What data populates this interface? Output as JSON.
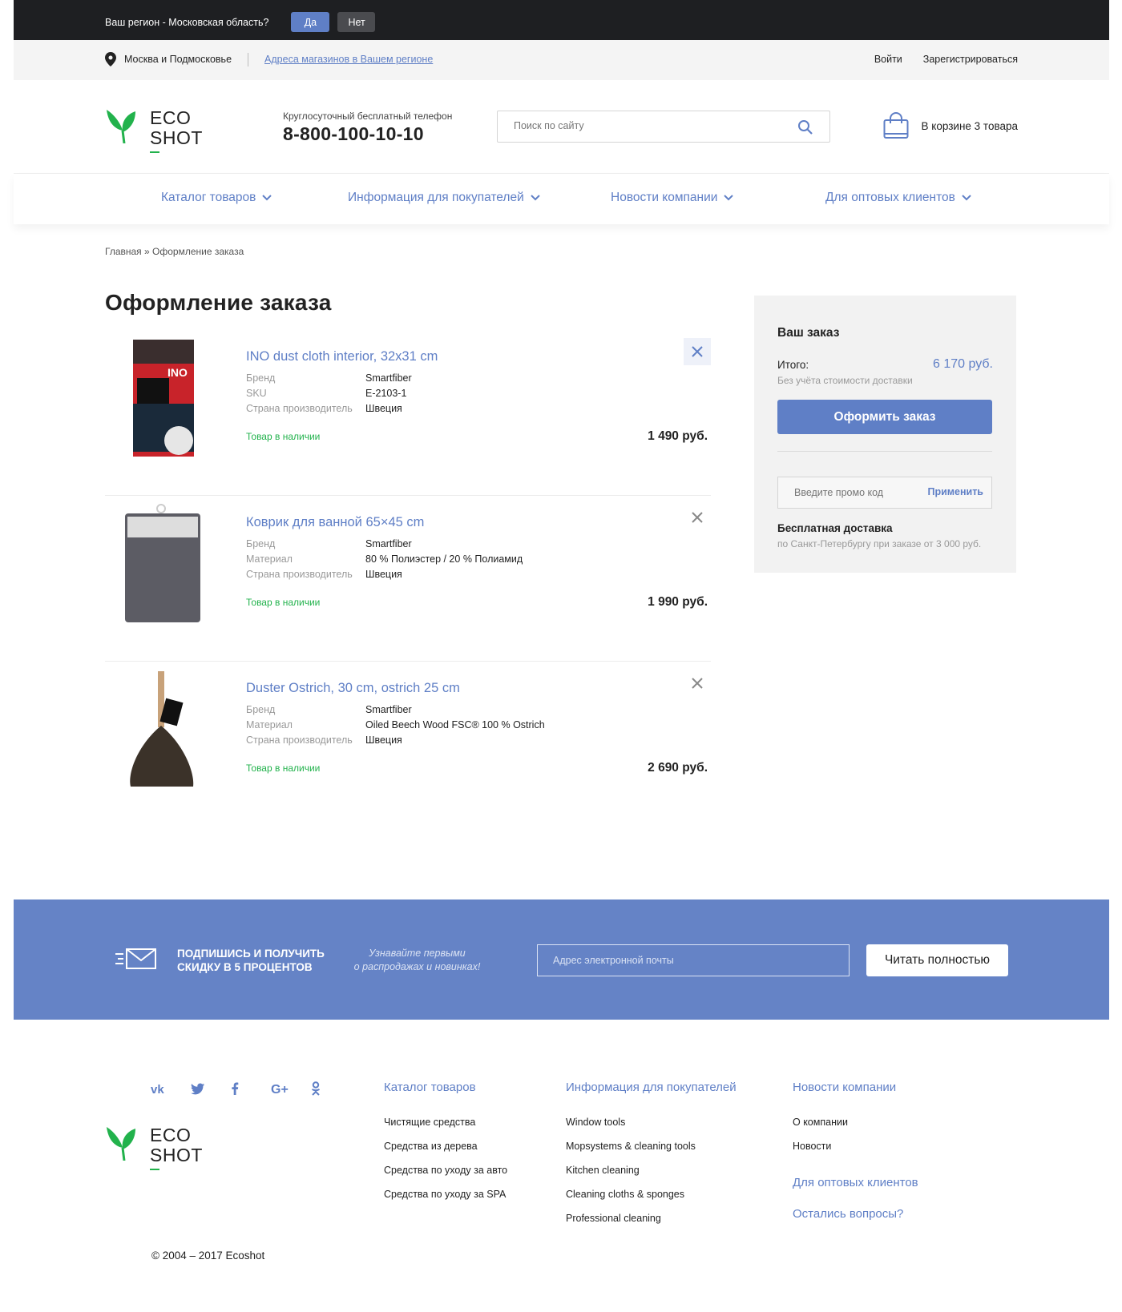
{
  "topbar": {
    "question": "Ваш регион - Московская область?",
    "yes": "Да",
    "no": "Нет"
  },
  "subbar": {
    "city": "Москва и Подмосковье",
    "stores_link": "Адреса магазинов в Вашем регионе",
    "login": "Войти",
    "register": "Зарегистрироваться"
  },
  "header": {
    "logo_line1": "ECO",
    "logo_line2": "SHOT",
    "phone_caption": "Круглосуточный бесплатный телефон",
    "phone": "8-800-100-10-10",
    "search_placeholder": "Поиск по сайту",
    "cart_text": "В корзине 3 товара"
  },
  "nav": [
    {
      "label": "Каталог товаров"
    },
    {
      "label": "Информация для покупателей"
    },
    {
      "label": "Новости компании"
    },
    {
      "label": "Для оптовых клиентов"
    }
  ],
  "breadcrumb": "Главная » Оформление заказа",
  "page_title": "Оформление заказа",
  "items": [
    {
      "name": "INO dust cloth interior, 32x31 cm",
      "props": [
        {
          "k": "Бренд",
          "v": "Smartfiber"
        },
        {
          "k": "SKU",
          "v": "E-2103-1"
        },
        {
          "k": "Страна производитель",
          "v": "Швеция"
        }
      ],
      "stock": "Товар в наличии",
      "price": "1 490 руб."
    },
    {
      "name": "Коврик для ванной 65×45 cm",
      "props": [
        {
          "k": "Бренд",
          "v": "Smartfiber"
        },
        {
          "k": "Материал",
          "v": "80 % Полиэстер / 20 % Полиамид"
        },
        {
          "k": "Страна производитель",
          "v": "Швеция"
        }
      ],
      "stock": "Товар в наличии",
      "price": "1 990 руб."
    },
    {
      "name": "Duster Ostrich, 30 cm, ostrich 25 cm",
      "props": [
        {
          "k": "Бренд",
          "v": "Smartfiber"
        },
        {
          "k": "Материал",
          "v": "Oiled Beech Wood FSC® 100 % Ostrich"
        },
        {
          "k": "Страна производитель",
          "v": "Швеция"
        }
      ],
      "stock": "Товар в наличии",
      "price": "2 690 руб."
    }
  ],
  "summary": {
    "heading": "Ваш заказ",
    "total_label": "Итого:",
    "total_value": "6 170 руб.",
    "note": "Без учёта стоимости доставки",
    "order_button": "Оформить заказ",
    "promo_placeholder": "Введите промо код",
    "apply": "Применить",
    "free_delivery": "Бесплатная доставка",
    "free_delivery_note": "по Санкт-Петербургу при заказе от 3 000 руб."
  },
  "subscribe": {
    "line1": "Подпишись и получить",
    "line2": "скидку в 5 процентов",
    "sub1": "Узнавайте первыми",
    "sub2": "о распродажах и новинках!",
    "email_placeholder": "Адрес электронной почты",
    "button": "Читать полностью"
  },
  "footer": {
    "socials": [
      "vk-icon",
      "twitter-icon",
      "facebook-icon",
      "google-plus-icon",
      "odnoklassniki-icon"
    ],
    "col1": {
      "heading": "Каталог товаров",
      "links": [
        "Чистящие средства",
        "Средства из дерева",
        "Средства по уходу за авто",
        "Средства по уходу за SPA"
      ]
    },
    "col2": {
      "heading": "Информация для покупателей",
      "links": [
        "Window tools",
        "Mopsystems & cleaning tools",
        "Kitchen cleaning",
        "Cleaning cloths & sponges",
        "Professional cleaning"
      ]
    },
    "col3": {
      "heading": "Новости компании",
      "links": [
        "О компании",
        "Новости"
      ],
      "extra1": "Для оптовых клиентов",
      "extra2": "Остались вопросы?"
    },
    "copyright": "© 2004 – 2017 Ecoshot"
  },
  "colors": {
    "accent": "#5f7fc6",
    "green": "#22b24c",
    "dark": "#1e1f22",
    "subscribe_bg": "#6583c6"
  }
}
